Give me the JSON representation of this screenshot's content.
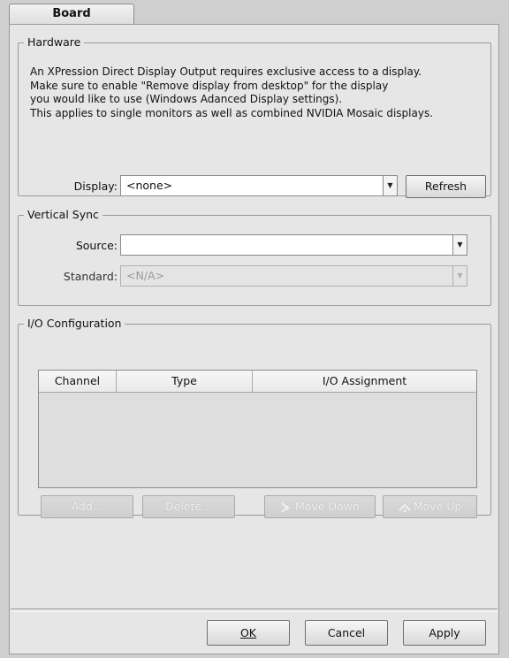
{
  "tabs": [
    {
      "label": "Board"
    }
  ],
  "hardware": {
    "title": "Hardware",
    "description": "An XPression Direct Display Output requires exclusive access to a display.\nMake sure to enable \"Remove display from desktop\" for the display\nyou would like to use (Windows Adanced Display settings).\nThis applies to single monitors as well as combined NVIDIA Mosaic displays.",
    "display_label": "Display:",
    "display_value": "<none>",
    "refresh_label": "Refresh"
  },
  "vertical_sync": {
    "title": "Vertical Sync",
    "source_label": "Source:",
    "source_value": "",
    "standard_label": "Standard:",
    "standard_value": "<N/A>"
  },
  "io_config": {
    "title": "I/O Configuration",
    "columns": [
      "Channel",
      "Type",
      "I/O Assignment"
    ],
    "rows": [],
    "add_label": "Add...",
    "delete_label": "Delete...",
    "move_down_label": "Move Down",
    "move_up_label": "Move Up"
  },
  "footer": {
    "ok_label": "OK",
    "cancel_label": "Cancel",
    "apply_label": "Apply"
  }
}
